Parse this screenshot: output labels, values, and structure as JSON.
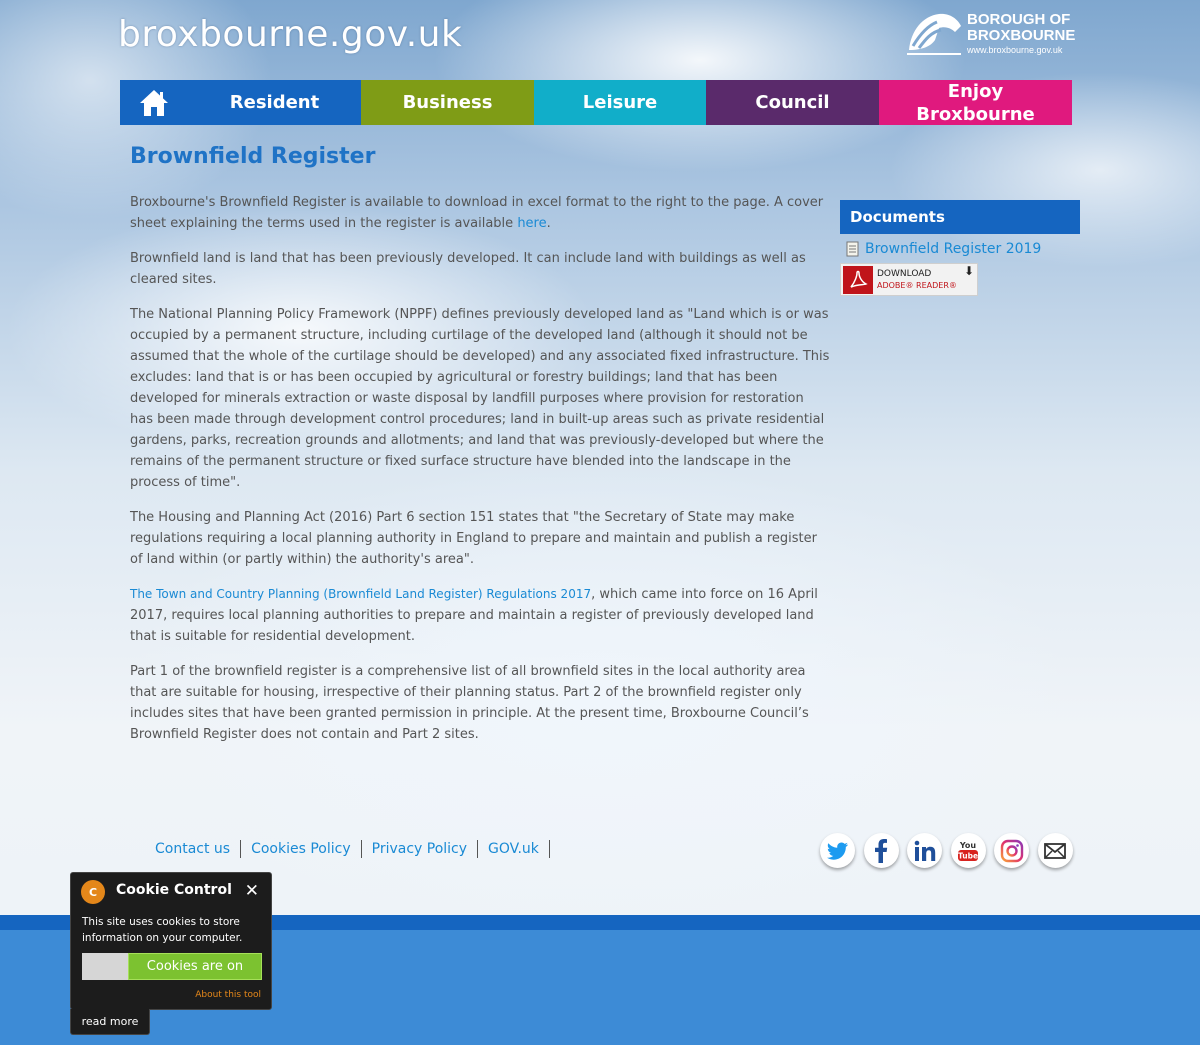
{
  "header": {
    "site_name": "broxbourne.gov.uk",
    "borough_logo": {
      "line1": "BOROUGH OF",
      "line2": "BROXBOURNE",
      "line3": "www.broxbourne.gov.uk"
    }
  },
  "nav": {
    "home_icon": "home-icon",
    "items": [
      {
        "label": "Resident",
        "color": "#1565c0"
      },
      {
        "label": "Business",
        "color": "#7f9c16"
      },
      {
        "label": "Leisure",
        "color": "#11aec9"
      },
      {
        "label": "Council",
        "color": "#5a2a6b"
      },
      {
        "label": "Enjoy Broxbourne",
        "color": "#e0197e"
      }
    ]
  },
  "page": {
    "title": "Brownfield Register",
    "p1_text": "Broxbourne's Brownfield Register is available to download in excel format to the right to the page. A cover sheet explaining the terms used in the register is available ",
    "p1_link": "here",
    "p1_end": ".",
    "p2": "Brownfield land is land that has been previously developed. It can include land with buildings as well as cleared sites.",
    "p3": "The National Planning Policy Framework (NPPF) defines previously developed land as \"Land which is or was occupied by a permanent structure, including curtilage of the developed land (although it should not be assumed that the whole of the curtilage should be developed) and any associated fixed infrastructure. This excludes: land that is or has been occupied by agricultural or forestry buildings; land that has been developed for minerals extraction or waste disposal by landfill purposes where provision for restoration has been made through development control procedures; land in built-up areas such as private residential gardens, parks, recreation grounds and allotments; and land that was previously-developed but where the remains of the permanent structure or fixed surface structure have blended into the landscape in the process of time\".",
    "p4": "The Housing and Planning Act (2016) Part 6 section 151 states that \"the Secretary of State may make regulations requiring a local planning authority in England to prepare and maintain and publish a register of land within (or partly within) the authority's area\".",
    "p5_link": "The Town and Country Planning (Brownfield Land Register) Regulations 2017",
    "p5_text": ", which came into force on 16 April 2017, requires local planning authorities to prepare and maintain a register of previously developed land that is suitable for residential development.",
    "p6": "Part 1 of the brownfield register is a comprehensive list of all brownfield sites in the local authority area that are suitable for housing, irrespective of their planning status. Part 2 of the brownfield register only includes sites that have been granted permission in principle. At the present time, Broxbourne Council’s Brownfield Register does not contain and Part 2 sites."
  },
  "documents": {
    "heading": "Documents",
    "items": [
      {
        "label": "Brownfield Register 2019",
        "icon": "document-icon"
      }
    ],
    "adobe": {
      "line1": "DOWNLOAD",
      "line2": "ADOBE® READER®"
    }
  },
  "footer": {
    "links": [
      "Contact us",
      "Cookies Policy",
      "Privacy Policy",
      "GOV.uk"
    ],
    "social": [
      "twitter-icon",
      "facebook-icon",
      "linkedin-icon",
      "youtube-icon",
      "instagram-icon",
      "email-icon"
    ]
  },
  "cookie": {
    "title": "Cookie Control",
    "icon_letter": "C",
    "text": "This site uses cookies to store information on your computer.",
    "toggle_label": "Cookies are on",
    "about": "About this tool",
    "read_more": "read more"
  }
}
